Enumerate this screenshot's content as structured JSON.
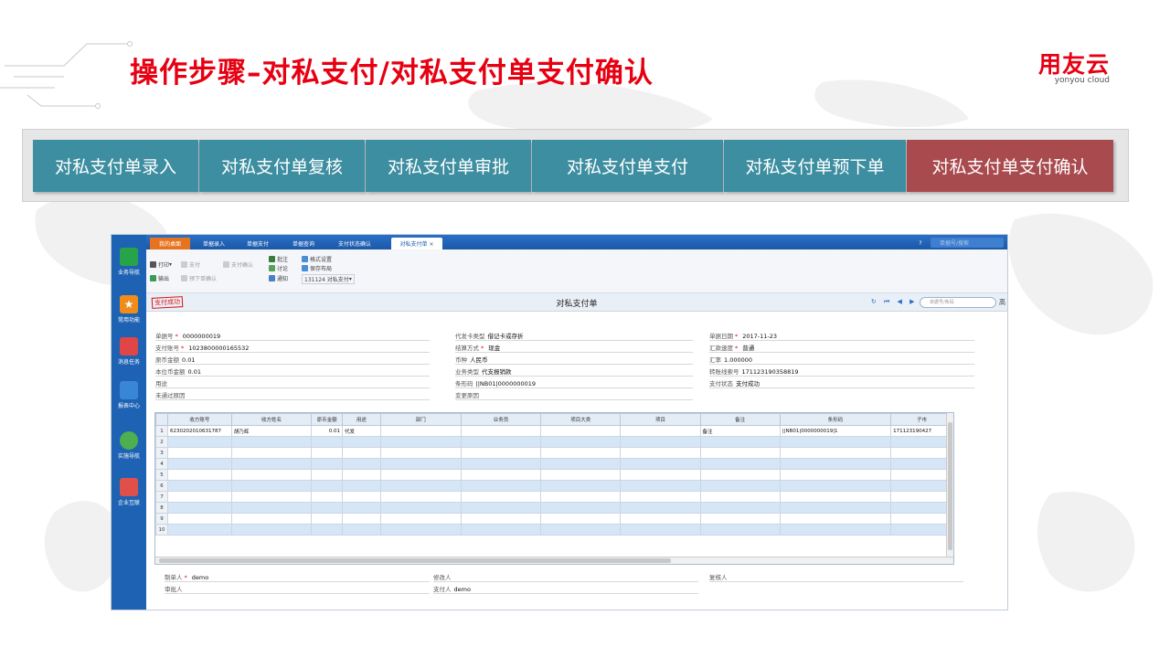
{
  "slide": {
    "title": "操作步骤–对私支付/对私支付单支付确认",
    "logo_cn": "用友云",
    "logo_en": "yonyou cloud",
    "colors": {
      "title_red": "#e60012",
      "step_teal": "#3d8ea0",
      "step_active": "#a94a4f"
    }
  },
  "steps": [
    {
      "label": "对私支付单录入"
    },
    {
      "label": "对私支付单复核"
    },
    {
      "label": "对私支付单审批"
    },
    {
      "label": "对私支付单支付"
    },
    {
      "label": "对私支付单预下单"
    },
    {
      "label": "对私支付单支付确认",
      "active": true
    }
  ],
  "app": {
    "leftbar": [
      {
        "label": "业务导航",
        "icon": "business-nav-icon",
        "color": "#27a34a"
      },
      {
        "label": "常用功能",
        "icon": "star-icon",
        "color": "#f08c1a"
      },
      {
        "label": "消息任务",
        "icon": "message-icon",
        "color": "#e04646"
      },
      {
        "label": "报表中心",
        "icon": "report-icon",
        "color": "#3a86d6"
      },
      {
        "label": "实施导航",
        "icon": "compass-icon",
        "color": "#4caf50"
      },
      {
        "label": "企业互联",
        "icon": "network-icon",
        "color": "#e0504a"
      }
    ],
    "tabs": [
      {
        "label": "我的桌面",
        "home": true
      },
      {
        "label": "单据录入"
      },
      {
        "label": "单据支付"
      },
      {
        "label": "单据查询"
      },
      {
        "label": "支付状态确认"
      },
      {
        "label": "对私支付单 ×",
        "active": true
      }
    ],
    "topbar_search_placeholder": "单据号/搜索",
    "toolbar": {
      "print": "打印",
      "pay": "支付",
      "pay_confirm": "支付确认",
      "approve": "批注",
      "format_settings": "格式设置",
      "export": "输出",
      "pre_order_confirm": "预下单确认",
      "discuss": "讨论",
      "save_layout": "保存布局",
      "notify": "通知",
      "template": "131124 对私支付"
    },
    "doc": {
      "stamp": "支付成功",
      "title": "对私支付单",
      "nav": "↻ ⏮ ◀ ▶ ⏭",
      "search_placeholder": "单据号/条码",
      "truncated_right": "高"
    },
    "form": {
      "bill_no_label": "单据号",
      "bill_no": "0000000019",
      "pay_account_label": "支付账号",
      "pay_account": "1023800000165532",
      "orig_amount_label": "原币金额",
      "orig_amount": "0.01",
      "local_amount_label": "本位币金额",
      "local_amount": "0.01",
      "purpose_label": "用途",
      "purpose": "",
      "unpass_reason_label": "未通过原因",
      "unpass_reason": "",
      "card_type_label": "代发卡类型",
      "card_type": "借记卡或存折",
      "settle_label": "结算方式",
      "settle": "现金",
      "currency_label": "币种",
      "currency": "人民币",
      "biz_type_label": "业务类型",
      "biz_type": "代支报销款",
      "barcode_label": "条形码",
      "barcode": "||NB01|0000000019",
      "change_reason_label": "变更原因",
      "change_reason": "",
      "date_label": "单据日期",
      "date": "2017-11-23",
      "remit_speed_label": "汇款速度",
      "remit_speed": "普通",
      "rate_label": "汇率",
      "rate": "1.000000",
      "serial_label": "转账线索号",
      "serial": "171123190358819",
      "pay_status_label": "支付状态",
      "pay_status": "支付成功"
    },
    "grid": {
      "headers": [
        "",
        "收方账号",
        "收方姓名",
        "原币金额",
        "用途",
        "部门",
        "业务员",
        "项目大类",
        "项目",
        "备注",
        "条形码",
        "子市"
      ],
      "rows": [
        [
          "1",
          "6230202010631787",
          "胡乃辉",
          "0.01",
          "代发",
          "",
          "",
          "",
          "",
          "备注",
          "||NB01|0000000019|1",
          "171123190427"
        ],
        [
          "2",
          "",
          "",
          "",
          "",
          "",
          "",
          "",
          "",
          "",
          "",
          ""
        ],
        [
          "3",
          "",
          "",
          "",
          "",
          "",
          "",
          "",
          "",
          "",
          "",
          ""
        ],
        [
          "4",
          "",
          "",
          "",
          "",
          "",
          "",
          "",
          "",
          "",
          "",
          ""
        ],
        [
          "5",
          "",
          "",
          "",
          "",
          "",
          "",
          "",
          "",
          "",
          "",
          ""
        ],
        [
          "6",
          "",
          "",
          "",
          "",
          "",
          "",
          "",
          "",
          "",
          "",
          ""
        ],
        [
          "7",
          "",
          "",
          "",
          "",
          "",
          "",
          "",
          "",
          "",
          "",
          ""
        ],
        [
          "8",
          "",
          "",
          "",
          "",
          "",
          "",
          "",
          "",
          "",
          "",
          ""
        ],
        [
          "9",
          "",
          "",
          "",
          "",
          "",
          "",
          "",
          "",
          "",
          "",
          ""
        ],
        [
          "10",
          "",
          "",
          "",
          "",
          "",
          "",
          "",
          "",
          "",
          "",
          ""
        ]
      ]
    },
    "footer": {
      "maker_label": "制单人",
      "maker": "demo",
      "approver_label": "审批人",
      "approver": "",
      "modifier_label": "修改人",
      "modifier": "",
      "payer_label": "支付人",
      "payer": "demo",
      "reviewer_label": "复核人",
      "reviewer": ""
    }
  }
}
